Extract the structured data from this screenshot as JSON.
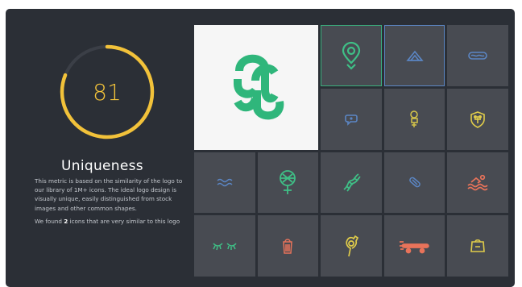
{
  "score": {
    "value": "81",
    "fraction": 0.81,
    "color": "#f2c23a"
  },
  "section": {
    "title": "Uniqueness",
    "description": "This metric is based on the similarity of the logo to our library of 1M+ icons. The ideal logo design is visually unique, easily distinguished from stock images and other common shapes.",
    "found_prefix": "We found ",
    "found_count": "2",
    "found_suffix": " icons that are very similar to this logo"
  },
  "colors": {
    "panel": "#2b2f36",
    "tile": "#484b52",
    "logo_green": "#2fb67b",
    "highlight_green": "#3aae7c",
    "highlight_blue": "#5b86c4"
  },
  "logo": {
    "name": "s-ribbon-logo",
    "color": "#2fb67b"
  },
  "icons": [
    {
      "name": "location-pin-icon",
      "color": "#3fbf86",
      "highlight": "green"
    },
    {
      "name": "pyramid-icon",
      "color": "#5b86c4",
      "highlight": "blue"
    },
    {
      "name": "hotdog-icon",
      "color": "#5b86c4",
      "highlight": ""
    },
    {
      "name": "chat-bubble-icon",
      "color": "#5b86c4",
      "highlight": ""
    },
    {
      "name": "figure-icon",
      "color": "#d4c44a",
      "highlight": ""
    },
    {
      "name": "shield-crest-icon",
      "color": "#e0cc4a",
      "highlight": ""
    },
    {
      "name": "waves-icon",
      "color": "#5b86c4",
      "highlight": ""
    },
    {
      "name": "female-symbol-icon",
      "color": "#3fbf86",
      "highlight": ""
    },
    {
      "name": "dna-icon",
      "color": "#3fbf86",
      "highlight": ""
    },
    {
      "name": "pill-icon",
      "color": "#5b86c4",
      "highlight": ""
    },
    {
      "name": "swimmer-icon",
      "color": "#e8735a",
      "highlight": ""
    },
    {
      "name": "eyelashes-icon",
      "color": "#3fbf86",
      "highlight": ""
    },
    {
      "name": "basket-icon",
      "color": "#e8735a",
      "highlight": ""
    },
    {
      "name": "strong-arm-icon",
      "color": "#e0cc4a",
      "highlight": ""
    },
    {
      "name": "skateboard-icon",
      "color": "#e8735a",
      "highlight": ""
    },
    {
      "name": "scale-weight-icon",
      "color": "#e0cc4a",
      "highlight": ""
    }
  ]
}
